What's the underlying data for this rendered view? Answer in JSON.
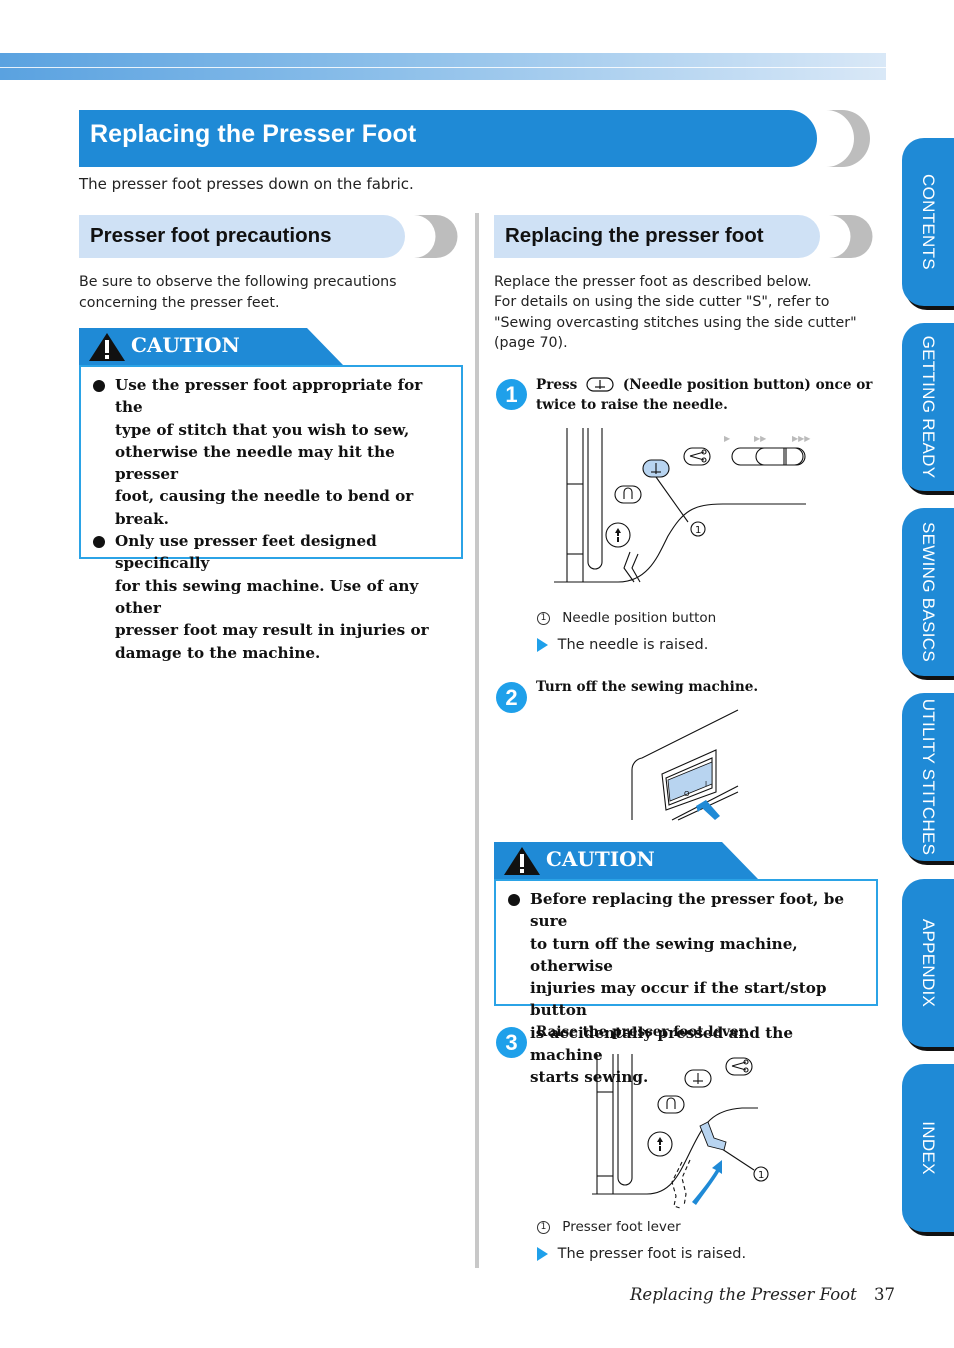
{
  "header": {
    "section_title": "Replacing the Presser Foot",
    "intro": "The presser foot presses down on the fabric."
  },
  "left": {
    "heading": "Presser foot precautions",
    "para_lines": [
      "Be sure to observe the following precautions",
      "concerning the presser feet."
    ],
    "caution": {
      "label": "CAUTION",
      "icon": "warning-triangle-icon",
      "items": [
        [
          "Use the presser foot appropriate for the",
          "type of stitch that you wish to sew,",
          "otherwise the needle may hit the presser",
          "foot, causing the needle to bend or break."
        ],
        [
          "Only use presser feet designed specifically",
          "for this sewing machine. Use of any other",
          "presser foot may result in injuries or",
          "damage to the machine."
        ]
      ]
    }
  },
  "right": {
    "heading": "Replacing the presser foot",
    "para_lines": [
      "Replace the presser foot as described below.",
      "For details on using the side cutter \"S\", refer to",
      "\"Sewing overcasting stitches using the side cutter\"",
      "(page 70)."
    ],
    "steps": [
      {
        "number": "1",
        "text_before_icon": "Press",
        "inline_icon": "needle-position-button-icon",
        "text_after_icon": "(Needle position button) once or",
        "text_line2": "twice to raise the needle.",
        "legend_num": "1",
        "legend": "Needle position button",
        "result": "The needle is raised.",
        "speed_marks": [
          "▶",
          "▶▶",
          "▶▶▶"
        ]
      },
      {
        "number": "2",
        "text": "Turn off the sewing machine.",
        "switch_labels": [
          "O",
          "I"
        ]
      },
      {
        "number": "3",
        "text": "Raise the presser foot lever.",
        "legend_num": "1",
        "legend": "Presser foot lever",
        "result": "The presser foot is raised."
      }
    ],
    "caution": {
      "label": "CAUTION",
      "icon": "warning-triangle-icon",
      "items": [
        [
          "Before replacing the presser foot, be sure",
          "to turn off the sewing machine, otherwise",
          "injuries may occur if the start/stop button",
          "is accidentally pressed and the machine",
          "starts sewing."
        ]
      ]
    }
  },
  "footer": {
    "title": "Replacing the Presser Foot",
    "page": "37"
  },
  "side_tabs": [
    {
      "label": "CONTENTS"
    },
    {
      "label": "GETTING READY"
    },
    {
      "label": "SEWING BASICS"
    },
    {
      "label": "UTILITY STITCHES"
    },
    {
      "label": "APPENDIX"
    },
    {
      "label": "INDEX"
    }
  ],
  "colors": {
    "accent_blue": "#1f8ad6",
    "step_blue": "#1fa0ea",
    "light_blue": "#cfe1f5",
    "caution_border": "#2ba3e6",
    "highlight_fill": "#b8d4f0",
    "cap_gray": "#bdbdbd"
  }
}
